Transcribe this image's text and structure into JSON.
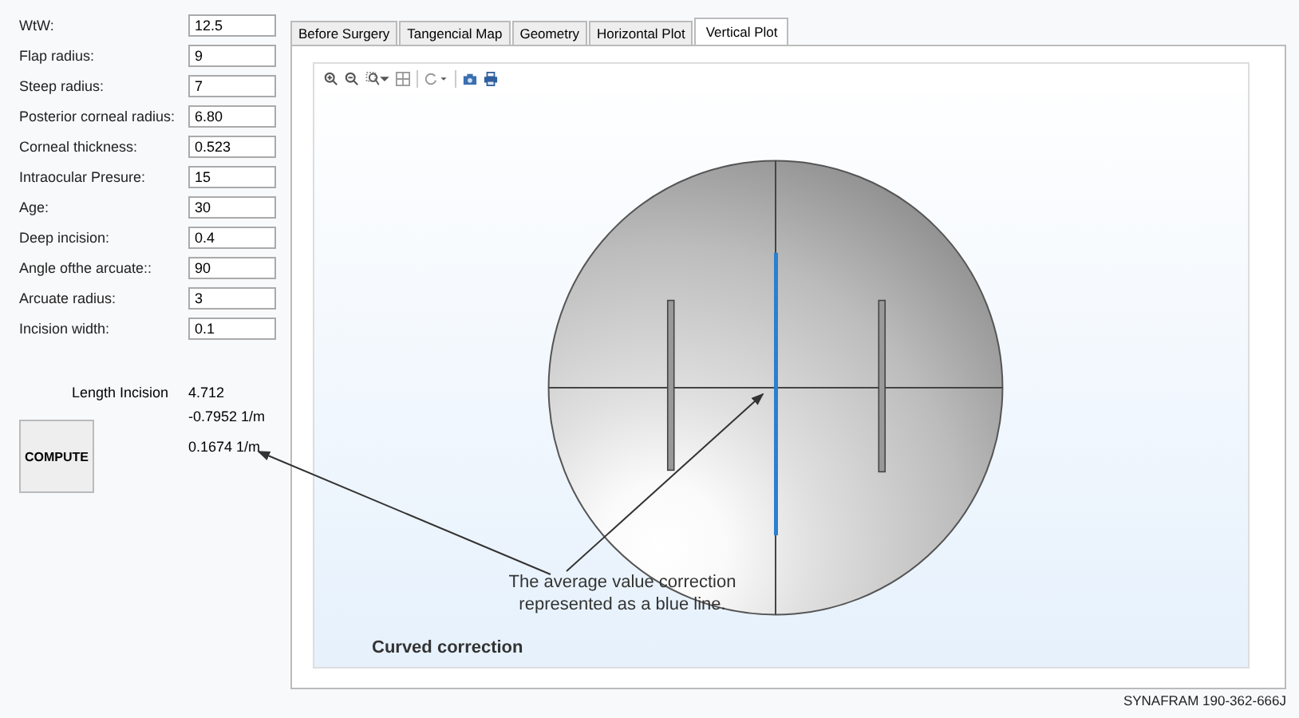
{
  "parameters": [
    {
      "label": "WtW:",
      "value": "12.5"
    },
    {
      "label": "Flap radius:",
      "value": "9"
    },
    {
      "label": "Steep radius:",
      "value": "7"
    },
    {
      "label": "Posterior corneal radius:",
      "value": "6.80"
    },
    {
      "label": "Corneal thickness:",
      "value": "0.523"
    },
    {
      "label": "Intraocular Presure:",
      "value": "15"
    },
    {
      "label": "Age:",
      "value": "30"
    },
    {
      "label": "Deep incision:",
      "value": "0.4"
    },
    {
      "label": "Angle ofthe arcuate::",
      "value": "90"
    },
    {
      "label": "Arcuate radius:",
      "value": "3"
    },
    {
      "label": "Incision width:",
      "value": "0.1"
    }
  ],
  "length_incision": {
    "label": "Length Incision",
    "value": "4.712"
  },
  "results": [
    "-0.7952 1/m",
    "0.1674 1/m"
  ],
  "compute_button": "COMPUTE",
  "tabs": [
    {
      "label": "Before Surgery",
      "selected": false
    },
    {
      "label": "Tangencial Map",
      "selected": false
    },
    {
      "label": "Geometry",
      "selected": false
    },
    {
      "label": "Horizontal Plot",
      "selected": false
    },
    {
      "label": "Vertical Plot",
      "selected": true
    }
  ],
  "plot": {
    "annotation": "The average value correction represented as a blue line.",
    "title": "Curved correction"
  },
  "footer": "SYNAFRAM  190-362-666J"
}
